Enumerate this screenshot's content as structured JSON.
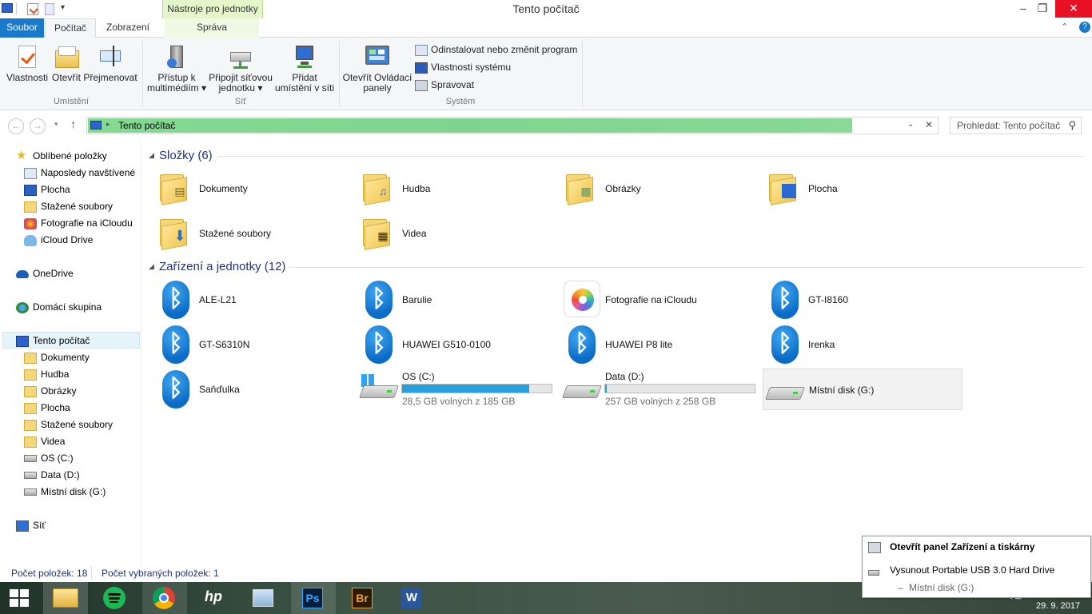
{
  "window": {
    "title": "Tento počítač",
    "context_tab": "Nástroje pro jednotky",
    "controls": {
      "minimize": "–",
      "maximize": "❐",
      "close": "✕"
    }
  },
  "tabs": [
    {
      "label": "Soubor"
    },
    {
      "label": "Počítač"
    },
    {
      "label": "Zobrazení"
    },
    {
      "label": "Správa"
    }
  ],
  "ribbon": {
    "location_group": {
      "label": "Umístění",
      "buttons": [
        {
          "label": "Vlastnosti",
          "icon": "properties-icon"
        },
        {
          "label": "Otevřít",
          "icon": "open-icon"
        },
        {
          "label": "Přejmenovat",
          "icon": "rename-icon"
        }
      ]
    },
    "network_group": {
      "label": "Síť",
      "buttons": [
        {
          "label1": "Přístup k",
          "label2": "multimédiím ▾",
          "icon": "media-access-icon"
        },
        {
          "label1": "Připojit síťovou",
          "label2": "jednotku ▾",
          "icon": "map-drive-icon"
        },
        {
          "label1": "Přidat",
          "label2": "umístění v síti",
          "icon": "add-network-location-icon"
        }
      ]
    },
    "system_group": {
      "label": "Systém",
      "big_button": {
        "label1": "Otevřít Ovládací",
        "label2": "panely",
        "icon": "control-panel-icon"
      },
      "items": [
        {
          "label": "Odinstalovat nebo změnit program",
          "icon": "uninstall-icon"
        },
        {
          "label": "Vlastnosti systému",
          "icon": "system-properties-icon"
        },
        {
          "label": "Spravovat",
          "icon": "manage-icon"
        }
      ]
    }
  },
  "address": {
    "path": "Tento počítač",
    "search_placeholder": "Prohledat: Tento počítač"
  },
  "sidebar": {
    "favorites": {
      "label": "Oblíbené položky",
      "items": [
        "Naposledy navštívené",
        "Plocha",
        "Stažené soubory",
        "Fotografie na iCloudu",
        "iCloud Drive"
      ]
    },
    "onedrive": "OneDrive",
    "homegroup": "Domácí skupina",
    "this_pc": {
      "label": "Tento počítač",
      "items": [
        "Dokumenty",
        "Hudba",
        "Obrázky",
        "Plocha",
        "Stažené soubory",
        "Videa",
        "OS (C:)",
        "Data (D:)",
        "Místní disk (G:)"
      ]
    },
    "network": "Síť"
  },
  "content": {
    "folders_title": "Složky (6)",
    "folders": [
      "Dokumenty",
      "Hudba",
      "Obrázky",
      "Plocha",
      "Stažené soubory",
      "Videa"
    ],
    "devices_title": "Zařízení a jednotky (12)",
    "devices": [
      {
        "name": "ALE-L21",
        "type": "bluetooth"
      },
      {
        "name": "Barulie",
        "type": "bluetooth"
      },
      {
        "name": "Fotografie na iCloudu",
        "type": "photos"
      },
      {
        "name": "GT-I8160",
        "type": "bluetooth"
      },
      {
        "name": "GT-S6310N",
        "type": "bluetooth"
      },
      {
        "name": "HUAWEI G510-0100",
        "type": "bluetooth"
      },
      {
        "name": "HUAWEI P8 lite",
        "type": "bluetooth"
      },
      {
        "name": "Irenka",
        "type": "bluetooth"
      },
      {
        "name": "Saňďulka",
        "type": "bluetooth"
      }
    ],
    "drives": [
      {
        "name": "OS (C:)",
        "free": "28,5 GB volných z 185 GB",
        "used_fraction": 0.85
      },
      {
        "name": "Data (D:)",
        "free": "257 GB volných z 258 GB",
        "used_fraction": 0.004
      },
      {
        "name": "Místní disk (G:)"
      }
    ]
  },
  "status": {
    "count": "Počet položek: 18",
    "selected": "Počet vybraných položek: 1"
  },
  "popup": {
    "title": "Otevřít panel Zařízení a tiskárny",
    "eject": "Vysunout Portable USB 3.0 Hard Drive",
    "eject_sub": "Místní disk (G:)"
  },
  "taskbar": {
    "apps": [
      "start-icon",
      "file-explorer-icon",
      "spotify-icon",
      "chrome-icon",
      "hp-icon",
      "app-icon",
      "photoshop-icon",
      "bridge-icon",
      "word-icon"
    ],
    "ps_label": "Ps",
    "br_label": "Br",
    "word_label": "W",
    "date": "29. 9. 2017"
  }
}
